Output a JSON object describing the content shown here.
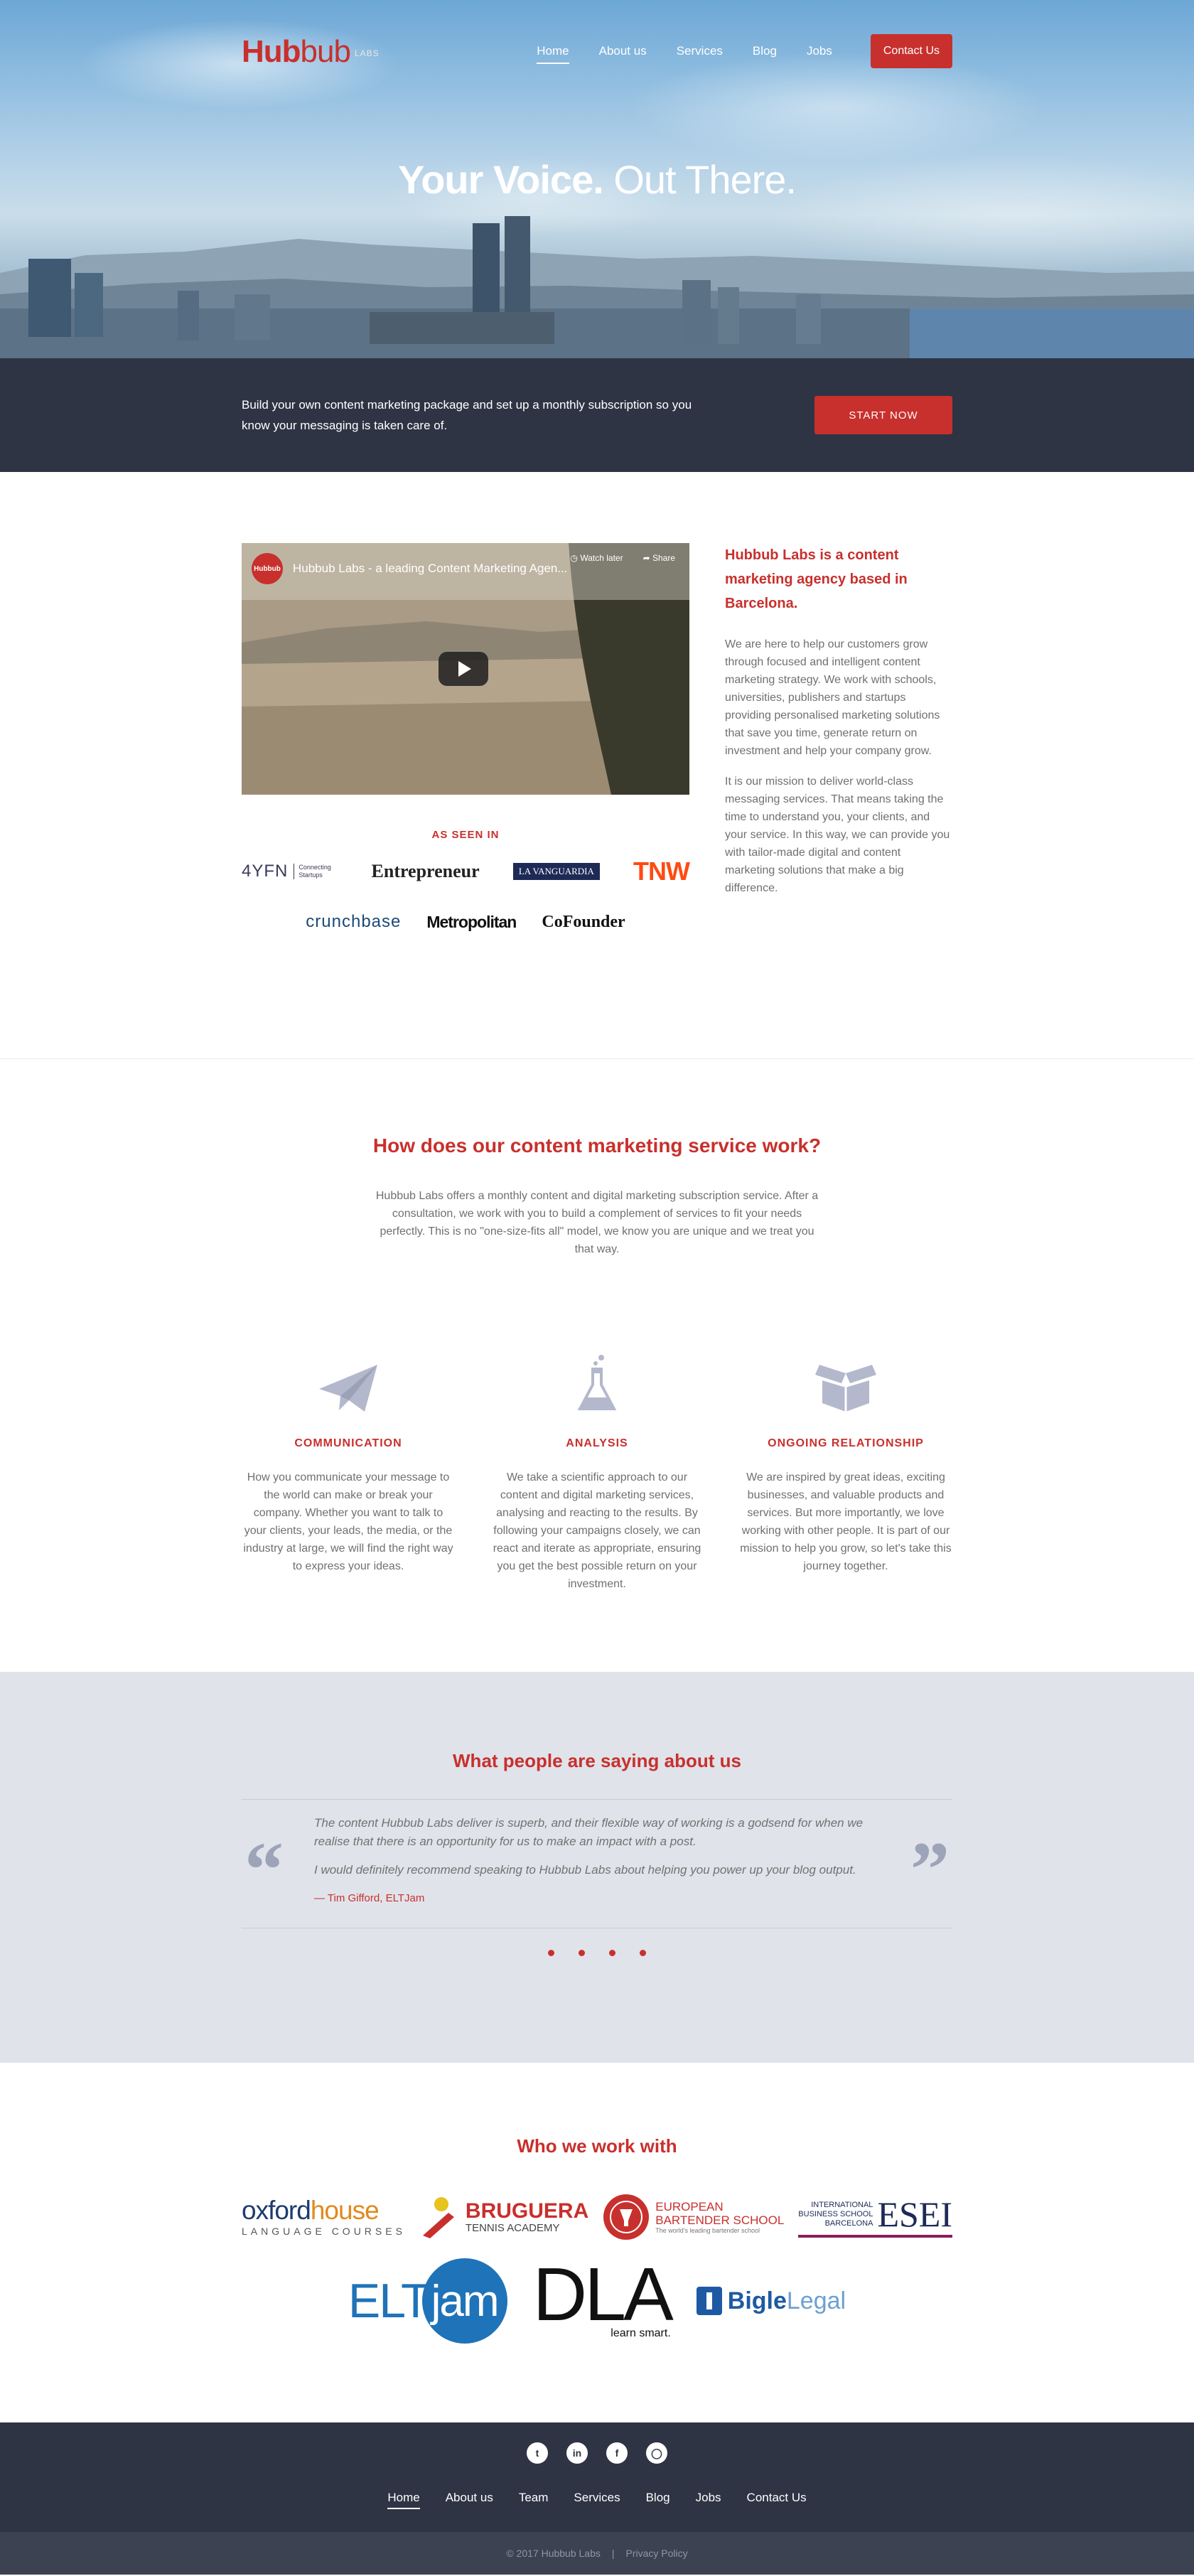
{
  "header": {
    "logo": {
      "part1": "Hub",
      "part2": "bub",
      "suffix": "LABS"
    },
    "nav": [
      {
        "label": "Home",
        "active": true
      },
      {
        "label": "About us"
      },
      {
        "label": "Services"
      },
      {
        "label": "Blog"
      },
      {
        "label": "Jobs"
      }
    ],
    "contact_button": "Contact Us"
  },
  "hero": {
    "headline_bold": "Your Voice.",
    "headline_light": "Out There."
  },
  "cta": {
    "text": "Build your own content marketing package and set up a monthly subscription so you know your messaging is taken care of.",
    "button": "START NOW"
  },
  "about": {
    "video": {
      "channel": "Hubbub",
      "title": "Hubbub Labs - a leading Content Marketing Agen...",
      "later": "Watch later",
      "share": "Share"
    },
    "as_seen_in": "AS SEEN IN",
    "press": [
      "4YFN",
      "Connecting Startups",
      "Entrepreneur",
      "LA VANGUARDIA",
      "TNW",
      "crunchbase",
      "Metropolitan",
      "CoFounder"
    ],
    "heading": "Hubbub Labs is a content marketing agency based in Barcelona.",
    "para1": "We are here to help our customers grow through focused and intelligent content marketing strategy. We work with schools, universities, publishers and startups providing personalised marketing solutions that save you time, generate return on investment and help your company grow.",
    "para2": "It is our mission to deliver world-class messaging services. That means taking the time to understand you, your clients, and your service. In this way, we can provide you with tailor-made digital and content marketing solutions that make a big difference."
  },
  "how": {
    "title": "How does our content marketing service work?",
    "intro": "Hubbub Labs offers a monthly content and digital marketing subscription service. After a consultation, we work with you to build a complement of services to fit your needs perfectly. This is no \"one-size-fits all\" model, we know you are unique and we treat you that way.",
    "columns": [
      {
        "icon": "paper-plane-icon",
        "title": "COMMUNICATION",
        "text": "How you communicate your message to the world can make or break your company. Whether you want to talk to your clients, your leads, the media, or the industry at large, we will find the right way to express your ideas."
      },
      {
        "icon": "flask-icon",
        "title": "ANALYSIS",
        "text": "We take a scientific approach to our content and digital marketing services, analysing and reacting to the results. By following your campaigns closely, we can react and iterate as appropriate, ensuring you get the best possible return on your investment."
      },
      {
        "icon": "open-box-icon",
        "title": "ONGOING RELATIONSHIP",
        "text": "We are inspired by great ideas, exciting businesses, and valuable products and services. But more importantly, we love working with other people. It is part of our mission to help you grow, so let's take this journey together."
      }
    ]
  },
  "testimonials": {
    "title": "What people are saying about us",
    "quote1": "The content Hubbub Labs deliver is superb, and their flexible way of working is a godsend for when we realise that there is an opportunity for us to make an impact with a post.",
    "quote2": "I would definitely recommend speaking to Hubbub Labs about helping you power up your blog output.",
    "author": "— Tim Gifford, ELTJam"
  },
  "clients": {
    "title": "Who we work with",
    "logos": {
      "oxford1": "oxford",
      "oxford2": "house",
      "oxford3": "LANGUAGE COURSES",
      "bruguera1": "BRUGUERA",
      "bruguera2": "TENNIS ACADEMY",
      "ebs1": "EUROPEAN",
      "ebs2": "BARTENDER SCHOOL",
      "ebs3": "The world's leading bartender school",
      "esei1": "INTERNATIONAL",
      "esei2": "BUSINESS SCHOOL",
      "esei3": "BARCELONA",
      "esei4": "ESEI",
      "eltjam1": "ELT",
      "eltjam2": "jam",
      "dla1": "DLA",
      "dla2": "learn smart.",
      "bigle1": "Bigle",
      "bigle2": "Legal"
    }
  },
  "footer": {
    "social": [
      "twitter-icon",
      "linkedin-icon",
      "facebook-icon",
      "instagram-icon"
    ],
    "nav": [
      {
        "label": "Home",
        "active": true
      },
      {
        "label": "About us"
      },
      {
        "label": "Team"
      },
      {
        "label": "Services"
      },
      {
        "label": "Blog"
      },
      {
        "label": "Jobs"
      },
      {
        "label": "Contact Us"
      }
    ],
    "copyright": "© 2017 Hubbub Labs",
    "separator": "|",
    "privacy": "Privacy Policy"
  },
  "colors": {
    "brand_red": "#c8302d",
    "dark_navy": "#2e3444",
    "testimonial_bg": "#e0e3ea"
  }
}
